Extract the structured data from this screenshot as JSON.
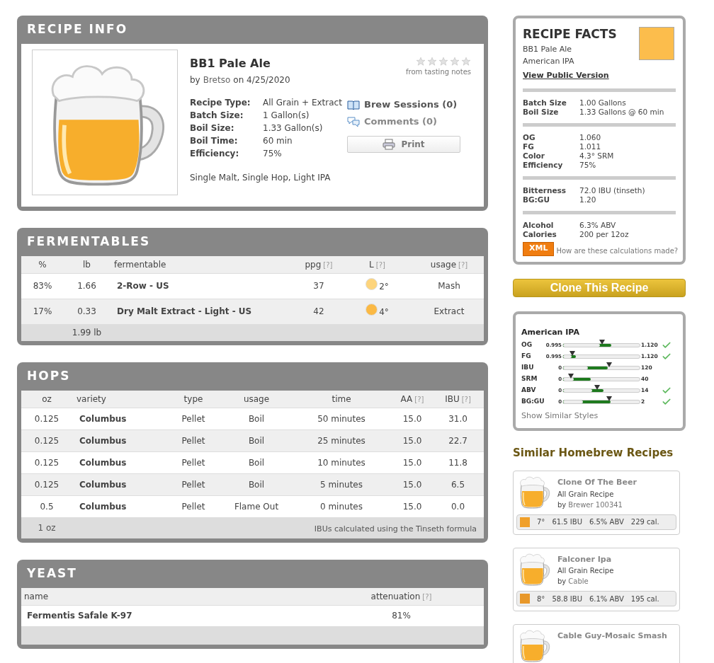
{
  "recipe_info": {
    "title": "RECIPE INFO",
    "name": "BB1 Pale Ale",
    "byline_prefix": "by",
    "author": "Bretso",
    "byline_date": "on 4/25/2020",
    "stars": 0,
    "rating_note": "from tasting notes",
    "details": [
      {
        "label": "Recipe Type:",
        "value": "All Grain + Extract"
      },
      {
        "label": "Batch Size:",
        "value": "1 Gallon(s)"
      },
      {
        "label": "Boil Size:",
        "value": "1.33 Gallon(s)"
      },
      {
        "label": "Boil Time:",
        "value": "60 min"
      },
      {
        "label": "Efficiency:",
        "value": "75%"
      }
    ],
    "tags": "Single Malt, Single Hop, Light IPA",
    "links": [
      {
        "kind": "sessions",
        "label": "Brew Sessions (0)"
      },
      {
        "kind": "comments",
        "label": "Comments (0)"
      }
    ],
    "print_button": "Print"
  },
  "fermentables": {
    "title": "FERMENTABLES",
    "columns": [
      {
        "label": "%"
      },
      {
        "label": "lb"
      },
      {
        "label": "fermentable"
      },
      {
        "label": "ppg",
        "help": "[?]"
      },
      {
        "label": "L",
        "help": "[?]"
      },
      {
        "label": "usage",
        "help": "[?]"
      }
    ],
    "rows": [
      {
        "percent": "83%",
        "lb": "1.66",
        "name": "2-Row - US",
        "ppg": "37",
        "color": "#fdd47c",
        "lovibond": "2°",
        "usage": "Mash"
      },
      {
        "percent": "17%",
        "lb": "0.33",
        "name": "Dry Malt Extract - Light - US",
        "ppg": "42",
        "color": "#fbb944",
        "lovibond": "4°",
        "usage": "Extract"
      }
    ],
    "total_lb": "1.99 lb"
  },
  "hops": {
    "title": "HOPS",
    "columns": [
      {
        "label": "oz"
      },
      {
        "label": "variety"
      },
      {
        "label": "type"
      },
      {
        "label": "usage"
      },
      {
        "label": "time"
      },
      {
        "label": "AA",
        "help": "[?]"
      },
      {
        "label": "IBU",
        "help": "[?]"
      }
    ],
    "rows": [
      {
        "oz": "0.125",
        "variety": "Columbus",
        "type": "Pellet",
        "usage": "Boil",
        "time": "50 minutes",
        "aa": "15.0",
        "ibu": "31.0"
      },
      {
        "oz": "0.125",
        "variety": "Columbus",
        "type": "Pellet",
        "usage": "Boil",
        "time": "25 minutes",
        "aa": "15.0",
        "ibu": "22.7"
      },
      {
        "oz": "0.125",
        "variety": "Columbus",
        "type": "Pellet",
        "usage": "Boil",
        "time": "10 minutes",
        "aa": "15.0",
        "ibu": "11.8"
      },
      {
        "oz": "0.125",
        "variety": "Columbus",
        "type": "Pellet",
        "usage": "Boil",
        "time": "5 minutes",
        "aa": "15.0",
        "ibu": "6.5"
      },
      {
        "oz": "0.5",
        "variety": "Columbus",
        "type": "Pellet",
        "usage": "Flame Out",
        "time": "0 minutes",
        "aa": "15.0",
        "ibu": "0.0"
      }
    ],
    "total": "1 oz",
    "note": "IBUs calculated using the Tinseth formula"
  },
  "yeast": {
    "title": "YEAST",
    "columns": [
      {
        "label": "name"
      },
      {
        "label": "attenuation",
        "help": "[?]"
      }
    ],
    "rows": [
      {
        "name": "Fermentis Safale K-97",
        "attenuation": "81%"
      }
    ]
  },
  "recipe_facts": {
    "title": "RECIPE FACTS",
    "color": "#fcbd4c",
    "name": "BB1 Pale Ale",
    "style": "American IPA",
    "public_link": "View Public Version",
    "groups": [
      [
        {
          "label": "Batch Size",
          "value": "1.00 Gallons"
        },
        {
          "label": "Boil Size",
          "value": "1.33 Gallons @ 60 min"
        }
      ],
      [
        {
          "label": "OG",
          "value": "1.060"
        },
        {
          "label": "FG",
          "value": "1.011"
        },
        {
          "label": "Color",
          "value": "4.3° SRM"
        },
        {
          "label": "Efficiency",
          "value": "75%"
        }
      ],
      [
        {
          "label": "Bitterness",
          "value": "72.0 IBU (tinseth)"
        },
        {
          "label": "BG:GU",
          "value": "1.20"
        }
      ],
      [
        {
          "label": "Alcohol",
          "value": "6.3% ABV"
        },
        {
          "label": "Calories",
          "value": "200 per 12oz"
        }
      ]
    ],
    "xml_button": "XML",
    "calc_link": "How are these calculations made?"
  },
  "clone_button": "Clone This Recipe",
  "style_guide": {
    "style": "American IPA",
    "rows": [
      {
        "label": "OG",
        "min": "0.995",
        "max": "1.120",
        "range_start": {
          "level": 0.48
        },
        "range_end": {
          "level": 0.63
        },
        "marker": {
          "level": 0.51
        },
        "in_range": true
      },
      {
        "label": "FG",
        "min": "0.995",
        "max": "1.120",
        "range_start": {
          "level": 0.11
        },
        "range_end": {
          "level": 0.17
        },
        "marker": {
          "level": 0.12
        },
        "in_range": true
      },
      {
        "label": "IBU",
        "min": "0",
        "max": "120",
        "range_start": {
          "level": 0.32
        },
        "range_end": {
          "level": 0.58
        },
        "marker": {
          "level": 0.6
        },
        "in_range": false
      },
      {
        "label": "SRM",
        "min": "0",
        "max": "40",
        "range_start": {
          "level": 0.14
        },
        "range_end": {
          "level": 0.36
        },
        "marker": {
          "level": 0.1
        },
        "in_range": false
      },
      {
        "label": "ABV",
        "min": "0",
        "max": "14",
        "range_start": {
          "level": 0.38
        },
        "range_end": {
          "level": 0.53
        },
        "marker": {
          "level": 0.44
        },
        "in_range": true
      },
      {
        "label": "BG:GU",
        "min": "0",
        "max": "2",
        "range_start": {
          "level": 0.26
        },
        "range_end": {
          "level": 0.62
        },
        "marker": {
          "level": 0.6
        },
        "in_range": true
      }
    ],
    "link": "Show Similar Styles"
  },
  "similar": {
    "title": "Similar Homebrew Recipes",
    "recipes": [
      {
        "name": "Clone Of The Beer",
        "type": "All Grain Recipe",
        "author_prefix": "by",
        "author": "Brewer 100341",
        "color": "#f0a02a",
        "srm": "7°",
        "ibu": "61.5 IBU",
        "abv": "6.5% ABV",
        "calories": "229 cal."
      },
      {
        "name": "Falconer Ipa",
        "type": "All Grain Recipe",
        "author_prefix": "by",
        "author": "Cable",
        "color": "#e8982a",
        "srm": "8°",
        "ibu": "58.8 IBU",
        "abv": "6.1% ABV",
        "calories": "195 cal."
      },
      {
        "name": "Cable Guy-Mosaic Smash"
      }
    ]
  }
}
